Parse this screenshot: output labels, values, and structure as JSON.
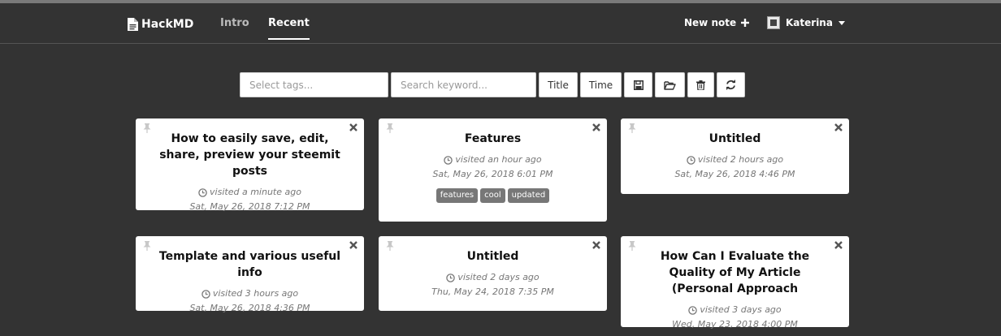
{
  "navbar": {
    "brand": "HackMD",
    "tabs": [
      {
        "label": "Intro",
        "active": false
      },
      {
        "label": "Recent",
        "active": true
      }
    ],
    "new_note": "New note",
    "user": "Katerina"
  },
  "toolbar": {
    "tags_placeholder": "Select tags...",
    "keyword_placeholder": "Search keyword...",
    "title_sort": "Title",
    "time_sort": "Time",
    "icons": [
      "save-icon",
      "folder-open-icon",
      "trash-icon",
      "refresh-icon"
    ]
  },
  "notes": [
    {
      "title": "How to easily save, edit, share, preview your steemit posts",
      "visited": "visited a minute ago",
      "date": "Sat, May 26, 2018 7:12 PM",
      "tags": []
    },
    {
      "title": "Features",
      "visited": "visited an hour ago",
      "date": "Sat, May 26, 2018 6:01 PM",
      "tags": [
        "features",
        "cool",
        "updated"
      ]
    },
    {
      "title": "Untitled",
      "visited": "visited 2 hours ago",
      "date": "Sat, May 26, 2018 4:46 PM",
      "tags": []
    },
    {
      "title": "Template and various useful info",
      "visited": "visited 3 hours ago",
      "date": "Sat, May 26, 2018 4:36 PM",
      "tags": []
    },
    {
      "title": "Untitled",
      "visited": "visited 2 days ago",
      "date": "Thu, May 24, 2018 7:35 PM",
      "tags": []
    },
    {
      "title": "How Can I Evaluate the Quality of My Article (Personal Approach",
      "visited": "visited 3 days ago",
      "date": "Wed, May 23, 2018 4:00 PM",
      "tags": []
    }
  ],
  "colors": {
    "background": "#333333",
    "card": "#ffffff",
    "tag": "#777777"
  }
}
